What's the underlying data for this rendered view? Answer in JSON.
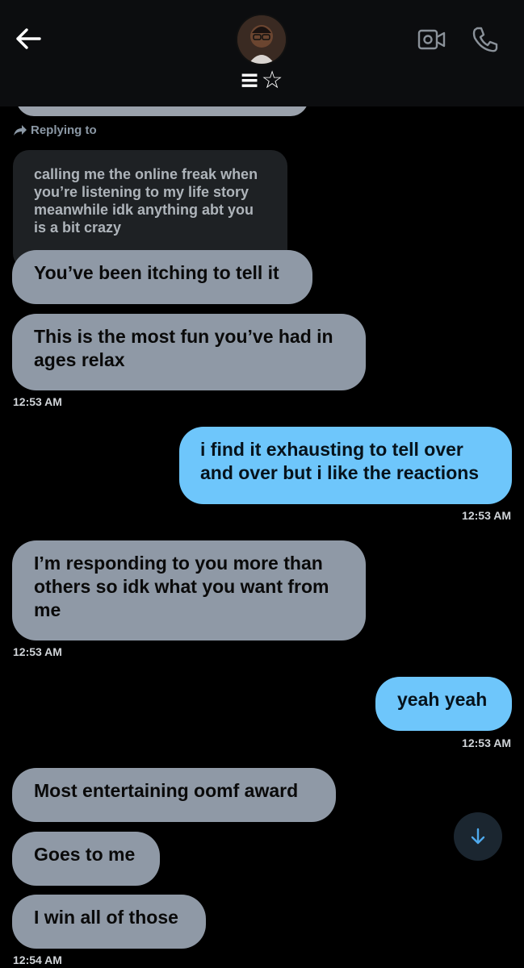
{
  "header": {
    "contact_name": "☰☆",
    "contact_name_display": "≡☆"
  },
  "reply": {
    "label": "Replying to",
    "quoted_text": "calling me the online freak when you’re listening to my life story meanwhile idk anything abt you is a bit crazy"
  },
  "messages": [
    {
      "text": "You’ve been itching to tell it"
    },
    {
      "text": "This is the most fun you’ve had in ages relax",
      "time": "12:53 AM"
    },
    {
      "text": "i find it exhausting to tell over and over but i like the reactions",
      "time": "12:53 AM"
    },
    {
      "text": "I’m responding to you more than others so idk what you want from me",
      "time": "12:53 AM"
    },
    {
      "text": "yeah yeah",
      "time": "12:53 AM"
    },
    {
      "text": "Most entertaining oomf award"
    },
    {
      "text": "Goes to me"
    },
    {
      "text": "I win all of those",
      "time": "12:54 AM"
    }
  ],
  "colors": {
    "incoming_bubble": "#8f99a6",
    "outgoing_bubble": "#6ec6fb",
    "background": "#000000"
  },
  "icons": [
    "back-arrow-icon",
    "video-call-icon",
    "phone-icon",
    "reply-arrow-icon",
    "scroll-down-icon"
  ]
}
